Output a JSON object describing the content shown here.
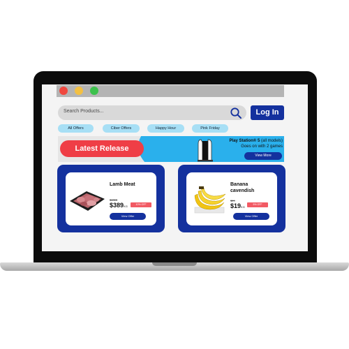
{
  "search": {
    "placeholder": "Search Products...",
    "icon": "search-icon"
  },
  "header": {
    "login_label": "Log In"
  },
  "filters": [
    "All Offers",
    "Ciber Offers",
    "Happy Hour",
    "Pink Friday"
  ],
  "banner": {
    "release_label": "Latest Release",
    "promo_title_bold": "Play Station® 5",
    "promo_title_rest": " (all models)",
    "promo_subtitle": "Goes on with 2 games",
    "view_more_label": "View More"
  },
  "products": [
    {
      "name": "Lamb Meat",
      "old_price": "$4015",
      "price": "$389",
      "unit": "KG",
      "discount": "10% OFF",
      "view_label": "View Offer"
    },
    {
      "name": "Banana cavendish",
      "old_price": "$29",
      "price": "$19",
      "unit": "KG",
      "discount": "5% OFF",
      "view_label": "View Offer"
    }
  ],
  "colors": {
    "primary": "#14319e",
    "accent": "#ef3e46",
    "pill": "#a7dff5",
    "wave": "#2ab0ec"
  }
}
